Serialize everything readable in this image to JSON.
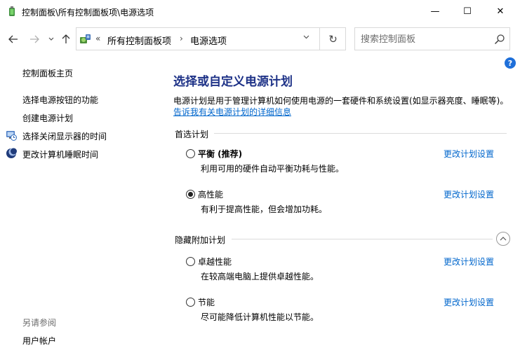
{
  "window": {
    "title": "控制面板\\所有控制面板项\\电源选项",
    "minimize_glyph": "—",
    "maximize_glyph": "☐",
    "close_glyph": "✕",
    "app_icon": "power-options-icon"
  },
  "nav": {
    "back_glyph": "←",
    "forward_glyph": "→",
    "recent_glyph": "⌄",
    "up_glyph": "↑"
  },
  "address": {
    "prefix": "«",
    "crumbs": [
      "所有控制面板项",
      "电源选项"
    ],
    "separator": "›",
    "dropdown_glyph": "⌄",
    "refresh_glyph": "↻"
  },
  "search": {
    "placeholder": "搜索控制面板"
  },
  "sidebar": {
    "home": "控制面板主页",
    "items": [
      {
        "label": "选择电源按钮的功能",
        "icon": ""
      },
      {
        "label": "创建电源计划",
        "icon": ""
      },
      {
        "label": "选择关闭显示器的时间",
        "icon": "display-clock-icon"
      },
      {
        "label": "更改计算机睡眠时间",
        "icon": "sleep-moon-icon"
      }
    ],
    "see_also_heading": "另请参阅",
    "see_also_items": [
      "用户帐户"
    ]
  },
  "help": {
    "glyph": "?"
  },
  "main": {
    "title": "选择或自定义电源计划",
    "description": "电源计划是用于管理计算机如何使用电源的一套硬件和系统设置(如显示器亮度、睡眠等)。",
    "info_link": "告诉我有关电源计划的详细信息",
    "preferred_heading": "首选计划",
    "hidden_heading": "隐藏附加计划",
    "change_link": "更改计划设置",
    "preferred_plans": [
      {
        "name": "平衡 (推荐)",
        "desc": "利用可用的硬件自动平衡功耗与性能。",
        "selected": false
      },
      {
        "name": "高性能",
        "desc": "有利于提高性能，但会增加功耗。",
        "selected": true
      }
    ],
    "hidden_plans": [
      {
        "name": "卓越性能",
        "desc": "在较高端电脑上提供卓越性能。",
        "selected": false
      },
      {
        "name": "节能",
        "desc": "尽可能降低计算机性能以节能。",
        "selected": false
      }
    ]
  }
}
